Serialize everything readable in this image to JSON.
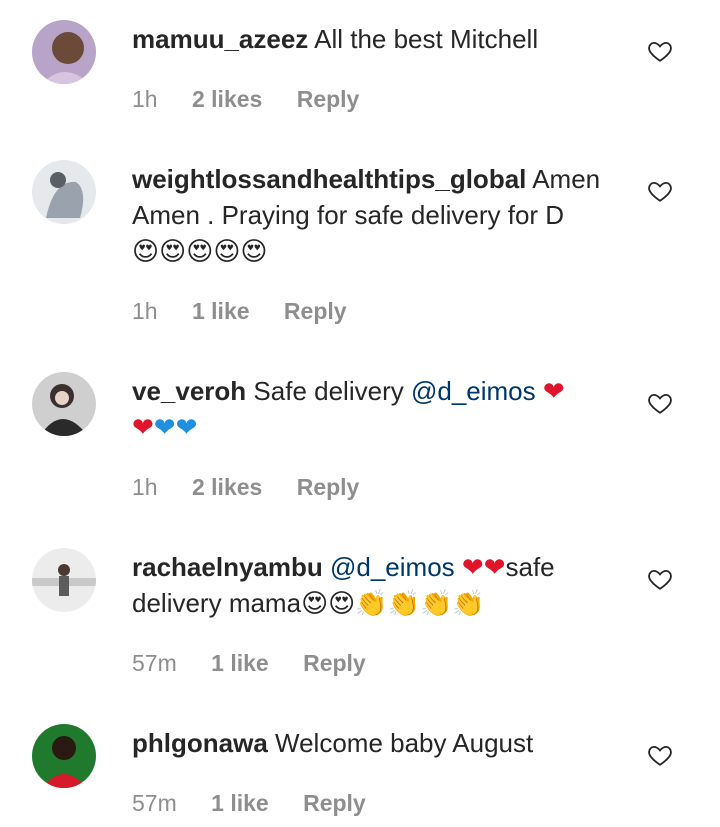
{
  "comments": [
    {
      "username": "mamuu_azeez",
      "text": "All the best Mitchell",
      "time": "1h",
      "likes": "2 likes",
      "reply": "Reply"
    },
    {
      "username": "weightlossandhealthtips_global",
      "text": "Amen Amen . Praying for safe delivery for D",
      "emojis": "😍😍😍😍😍",
      "time": "1h",
      "likes": "1 like",
      "reply": "Reply"
    },
    {
      "username": "ve_veroh",
      "text_before": "Safe delivery",
      "mention": "@d_eimos",
      "hearts": [
        "red-heart",
        "red-heart",
        "blue-heart",
        "blue-heart"
      ],
      "time": "1h",
      "likes": "2 likes",
      "reply": "Reply"
    },
    {
      "username": "rachaelnyambu",
      "mention": "@d_eimos",
      "hearts": [
        "red-heart",
        "red-heart"
      ],
      "text_after": "safe delivery mama",
      "emojis": "😍😍👏👏👏👏",
      "time": "57m",
      "likes": "1 like",
      "reply": "Reply"
    },
    {
      "username": "phlgonawa",
      "text": "Welcome baby August",
      "time": "57m",
      "likes": "1 like",
      "reply": "Reply"
    }
  ]
}
